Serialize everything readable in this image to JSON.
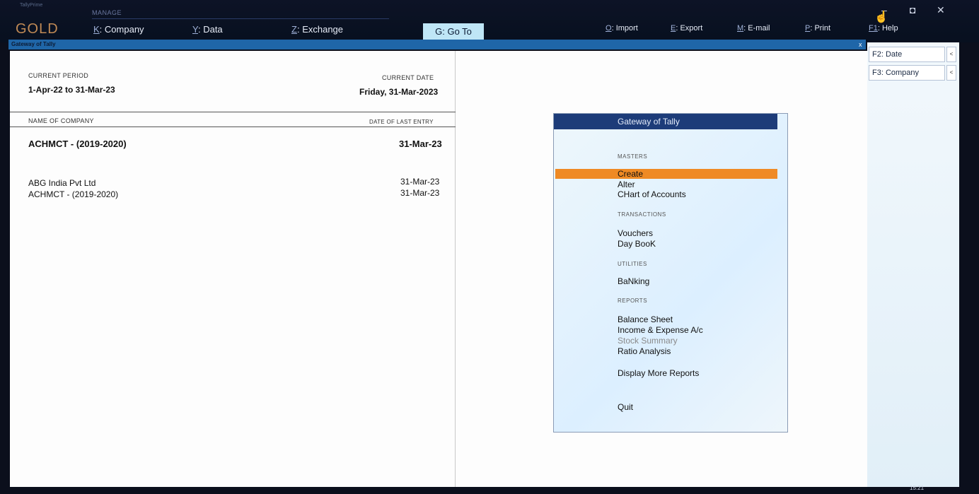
{
  "topbar": {
    "brand": "GOLD",
    "brand_sub": "TallyPrime",
    "manage_label": "MANAGE",
    "menu": [
      {
        "key": "K",
        "label": "Company"
      },
      {
        "key": "Y",
        "label": "Data"
      },
      {
        "key": "Z",
        "label": "Exchange"
      }
    ],
    "goto": {
      "key": "G",
      "label": "Go To"
    },
    "actions": [
      {
        "key": "O",
        "label": "Import"
      },
      {
        "key": "E",
        "label": "Export"
      },
      {
        "key": "M",
        "label": "E-mail"
      },
      {
        "key": "P",
        "label": "Print"
      },
      {
        "key": "F1",
        "label": "Help"
      }
    ],
    "window_buttons": {
      "minimize": "–",
      "maximize": "◘",
      "close": "✕"
    }
  },
  "title_strip": {
    "title": "Gateway of Tally",
    "close": "x"
  },
  "left": {
    "current_period_label": "CURRENT PERIOD",
    "current_period_value": "1-Apr-22 to 31-Mar-23",
    "current_date_label": "CURRENT DATE",
    "current_date_value": "Friday, 31-Mar-2023",
    "name_col": "NAME OF COMPANY",
    "date_col": "DATE OF LAST ENTRY",
    "active_company": {
      "name": "ACHMCT - (2019-2020)",
      "date": "31-Mar-23"
    },
    "companies": [
      {
        "name": "ABG India Pvt Ltd",
        "date": "31-Mar-23"
      },
      {
        "name": "ACHMCT - (2019-2020)",
        "date": "31-Mar-23"
      }
    ]
  },
  "gateway": {
    "title": "Gateway of Tally",
    "masters_label": "MASTERS",
    "create": "Create",
    "alter": "Alter",
    "chart": "CHart of Accounts",
    "transactions_label": "TRANSACTIONS",
    "vouchers": "Vouchers",
    "daybook": "Day BooK",
    "utilities_label": "UTILITIES",
    "banking": "BaNking",
    "reports_label": "REPORTS",
    "balance_sheet": "Balance Sheet",
    "income_expense": "Income & Expense A/c",
    "stock_summary": "Stock Summary",
    "ratio_analysis": "Ratio Analysis",
    "more_reports": "Display More Reports",
    "quit": "Quit"
  },
  "right_panel": {
    "buttons": [
      {
        "label": "F2: Date",
        "arrow": "<"
      },
      {
        "label": "F3: Company",
        "arrow": "<"
      }
    ]
  },
  "taskbar": {
    "time": "15:21"
  }
}
